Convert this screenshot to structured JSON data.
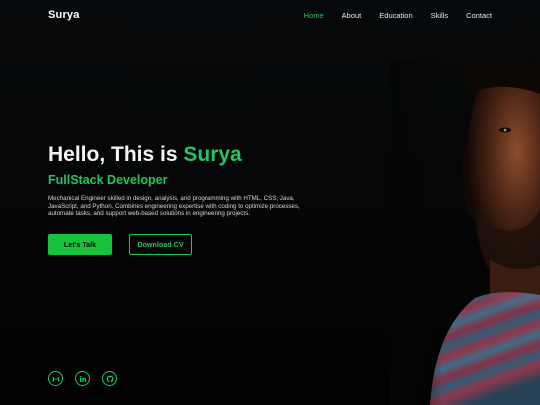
{
  "brand": {
    "name": "Surya"
  },
  "nav": {
    "items": [
      {
        "label": "Home",
        "active": true
      },
      {
        "label": "About",
        "active": false
      },
      {
        "label": "Education",
        "active": false
      },
      {
        "label": "Skills",
        "active": false
      },
      {
        "label": "Contact",
        "active": false
      }
    ]
  },
  "hero": {
    "greeting": "Hello, This is",
    "name": "Surya",
    "role": "FullStack Developer",
    "description": "Mechanical Engineer skilled in design, analysis, and programming with HTML, CSS, Java, JavaScript, and Python. Combines engineering expertise with coding to optimize processes, automate tasks, and support web-based solutions in engineering projects.",
    "primary_cta": "Let's Talk",
    "secondary_cta": "Download CV"
  },
  "social": [
    {
      "icon": "gmail-icon"
    },
    {
      "icon": "linkedin-icon"
    },
    {
      "icon": "github-icon"
    }
  ],
  "colors": {
    "accent": "#22c55e",
    "background": "#040506",
    "text": "#ffffff"
  }
}
